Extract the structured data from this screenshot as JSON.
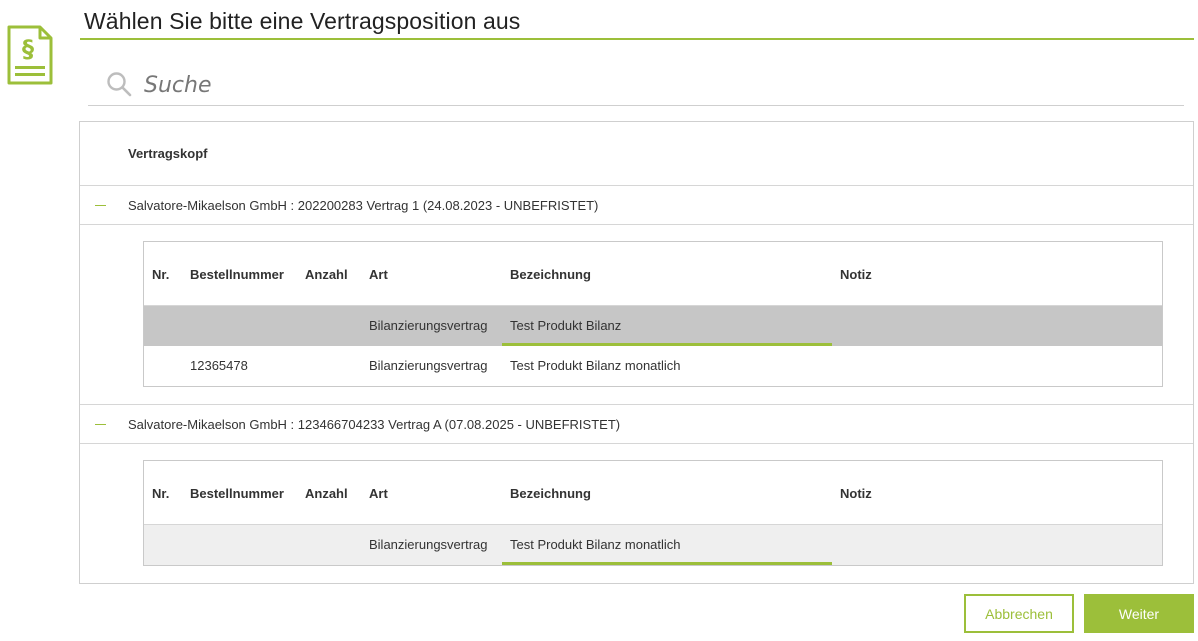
{
  "header": {
    "title": "Wählen Sie bitte eine Vertragsposition aus",
    "icon": "contract-paragraph-icon"
  },
  "search": {
    "placeholder": "Suche",
    "value": ""
  },
  "table": {
    "header_label": "Vertragskopf",
    "columns": [
      "Nr.",
      "Bestellnummer",
      "Anzahl",
      "Art",
      "Bezeichnung",
      "Notiz"
    ],
    "groups": [
      {
        "label": "Salvatore-Mikaelson GmbH : 202200283 Vertrag 1 (24.08.2023 - UNBEFRISTET)",
        "expanded": true,
        "rows": [
          {
            "nr": "",
            "bestellnummer": "",
            "anzahl": "",
            "art": "Bilanzierungsvertrag",
            "bezeichnung": "Test Produkt Bilanz",
            "notiz": "",
            "state": "selected"
          },
          {
            "nr": "",
            "bestellnummer": "12365478",
            "anzahl": "",
            "art": "Bilanzierungsvertrag",
            "bezeichnung": "Test Produkt Bilanz monatlich",
            "notiz": "",
            "state": "normal"
          }
        ]
      },
      {
        "label": "Salvatore-Mikaelson GmbH : 123466704233 Vertrag A (07.08.2025 - UNBEFRISTET)",
        "expanded": true,
        "rows": [
          {
            "nr": "",
            "bestellnummer": "",
            "anzahl": "",
            "art": "Bilanzierungsvertrag",
            "bezeichnung": "Test Produkt Bilanz monatlich",
            "notiz": "",
            "state": "hover"
          }
        ]
      }
    ]
  },
  "buttons": {
    "cancel": "Abbrechen",
    "next": "Weiter"
  },
  "colors": {
    "accent": "#9cbf3a",
    "selected_row": "#c6c6c6",
    "hover_row": "#efefef"
  }
}
